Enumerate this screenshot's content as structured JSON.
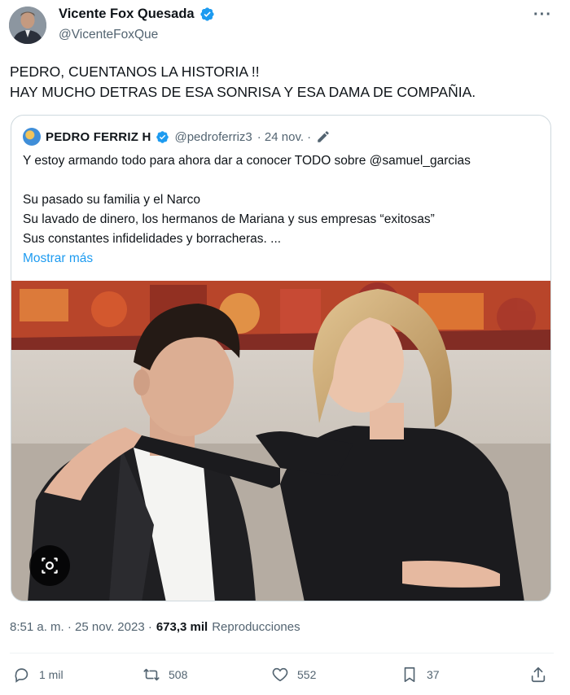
{
  "author": {
    "name": "Vicente Fox Quesada",
    "handle": "@VicenteFoxQue"
  },
  "more_label": "···",
  "tweet_text": "PEDRO, CUENTANOS LA HISTORIA !!\nHAY MUCHO DETRAS DE ESA SONRISA Y ESA DAMA DE COMPAÑIA.",
  "quote": {
    "name": "PEDRO FERRIZ H",
    "handle": "@pedroferriz3",
    "date": "· 24 nov. ·",
    "text": "Y estoy armando todo para ahora dar a conocer TODO sobre @samuel_garcias\n\nSu pasado su familia y  el Narco\nSu lavado de dinero, los hermanos de Mariana y sus empresas “exitosas”\nSus constantes infidelidades y borracheras. ...",
    "show_more": "Mostrar más"
  },
  "meta": {
    "time": "8:51 a. m. · 25 nov. 2023 ·",
    "views_count": "673,3 mil",
    "views_label": "Reproducciones"
  },
  "actions": {
    "replies": "1 mil",
    "retweets": "508",
    "likes": "552",
    "bookmarks": "37"
  },
  "colors": {
    "verified": "#1d9bf0",
    "secondary_text": "#536471",
    "link": "#1d9bf0"
  }
}
